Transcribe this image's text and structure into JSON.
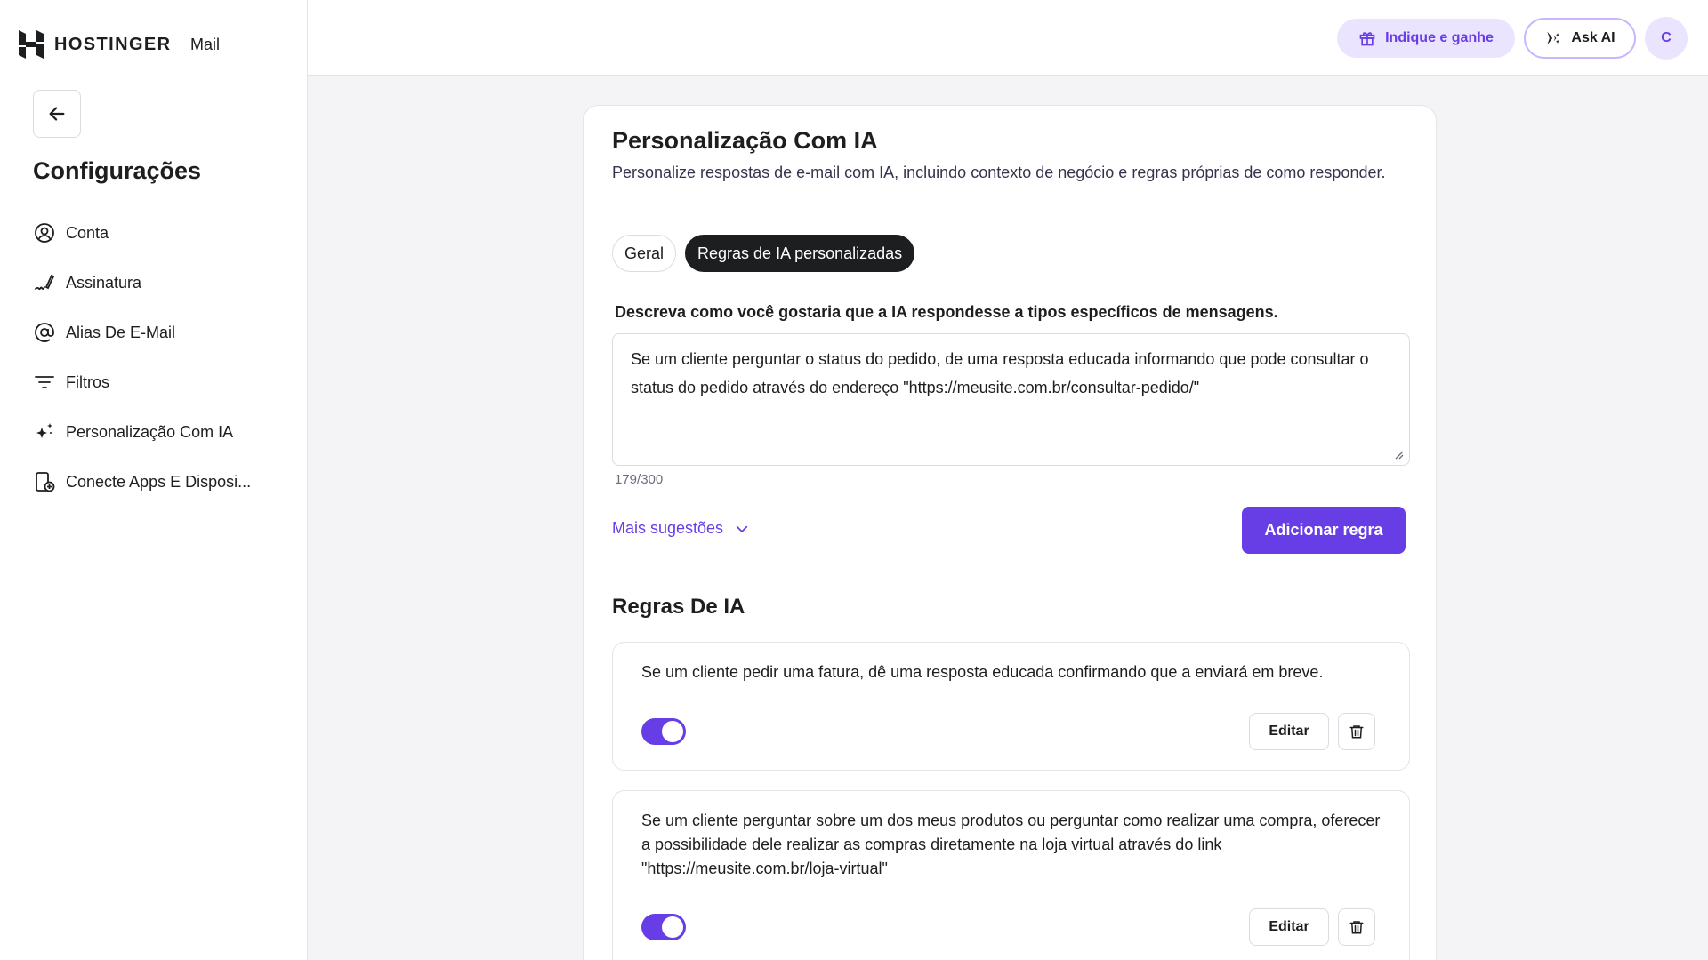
{
  "brand": {
    "name": "HOSTINGER",
    "product": "Mail"
  },
  "sidebar": {
    "title": "Configurações",
    "items": [
      {
        "label": "Conta",
        "icon": "user-circle-icon"
      },
      {
        "label": "Assinatura",
        "icon": "signature-icon"
      },
      {
        "label": "Alias De E-Mail",
        "icon": "at-sign-icon"
      },
      {
        "label": "Filtros",
        "icon": "filter-icon"
      },
      {
        "label": "Personalização Com IA",
        "icon": "sparkles-icon"
      },
      {
        "label": "Conecte Apps E Disposi...",
        "icon": "device-add-icon"
      }
    ]
  },
  "topbar": {
    "refer_label": "Indique e ganhe",
    "askai_label": "Ask AI",
    "avatar_initial": "C"
  },
  "card": {
    "title": "Personalização Com IA",
    "description": "Personalize respostas de e-mail com IA, incluindo contexto de negócio e regras próprias de como responder.",
    "tabs": [
      {
        "label": "Geral",
        "active": false
      },
      {
        "label": "Regras de IA personalizadas",
        "active": true
      }
    ],
    "prompt_label": "Descreva como você gostaria que a IA respondesse a tipos específicos de mensagens.",
    "prompt_value": "Se um cliente perguntar o status do pedido, de uma resposta educada informando que pode consultar o status do pedido através do endereço \"https://meusite.com.br/consultar-pedido/\"",
    "counter": "179/300",
    "more_suggestions": "Mais sugestões",
    "add_rule": "Adicionar regra"
  },
  "rules": {
    "title": "Regras De IA",
    "items": [
      {
        "text": "Se um cliente pedir uma fatura, dê uma resposta educada confirmando que a enviará em breve.",
        "enabled": true,
        "edit_label": "Editar"
      },
      {
        "text": "Se um cliente perguntar sobre um dos meus produtos ou perguntar como realizar uma compra, oferecer a possibilidade dele realizar as compras diretamente na loja virtual através do link \"https://meusite.com.br/loja-virtual\"",
        "enabled": true,
        "edit_label": "Editar"
      }
    ]
  },
  "colors": {
    "accent": "#673de6",
    "accent_light": "#ebe4ff",
    "text": "#1d1e20",
    "border": "#dadce0",
    "background": "#f4f4f6"
  }
}
